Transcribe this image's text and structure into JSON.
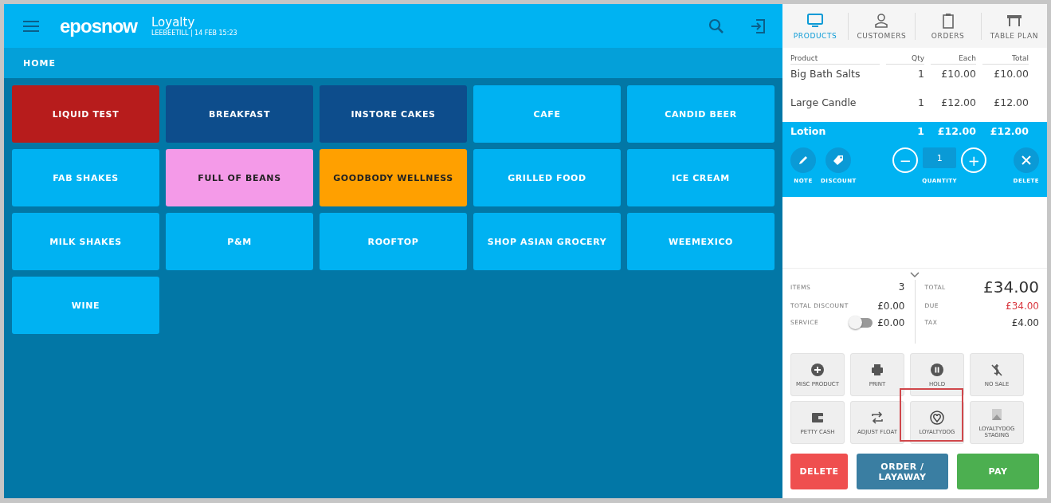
{
  "header": {
    "logo": "eposnow",
    "title": "Loyalty",
    "subtitle": "LEEBEETILL | 14 FEB 15:23"
  },
  "breadcrumb": "HOME",
  "categories": [
    {
      "label": "LIQUID TEST",
      "color": "#b71c1c"
    },
    {
      "label": "BREAKFAST",
      "color": "#0d4d8c"
    },
    {
      "label": "INSTORE CAKES",
      "color": "#0d4d8c"
    },
    {
      "label": "CAFE",
      "color": "#00b2f2"
    },
    {
      "label": "CANDID BEER",
      "color": "#00b2f2"
    },
    {
      "label": "FAB SHAKES",
      "color": "#00b2f2"
    },
    {
      "label": "FULL OF BEANS",
      "color": "#f49ae8"
    },
    {
      "label": "GOODBODY WELLNESS",
      "color": "#ffa000"
    },
    {
      "label": "GRILLED FOOD",
      "color": "#00b2f2"
    },
    {
      "label": "ICE CREAM",
      "color": "#00b2f2"
    },
    {
      "label": "MILK SHAKES",
      "color": "#00b2f2"
    },
    {
      "label": "P&M",
      "color": "#00b2f2"
    },
    {
      "label": "ROOFTOP",
      "color": "#00b2f2"
    },
    {
      "label": "SHOP ASIAN GROCERY",
      "color": "#00b2f2"
    },
    {
      "label": "WEEMEXICO",
      "color": "#00b2f2"
    },
    {
      "label": "WINE",
      "color": "#00b2f2"
    }
  ],
  "tabs": [
    {
      "kind": "monitor",
      "label": "PRODUCTS",
      "selected": true
    },
    {
      "kind": "person",
      "label": "CUSTOMERS",
      "selected": false
    },
    {
      "kind": "clipboard",
      "label": "ORDERS",
      "selected": false
    },
    {
      "kind": "table",
      "label": "TABLE PLAN",
      "selected": false
    }
  ],
  "order": {
    "columns": [
      "Product",
      "Qty",
      "Each",
      "Total"
    ],
    "rows": [
      {
        "product": "Big Bath Salts",
        "qty": "1",
        "each": "£10.00",
        "total": "£10.00",
        "selected": false
      },
      {
        "product": "Large Candle",
        "qty": "1",
        "each": "£12.00",
        "total": "£12.00",
        "selected": false
      },
      {
        "product": "Lotion",
        "qty": "1",
        "each": "£12.00",
        "total": "£12.00",
        "selected": true
      }
    ],
    "actions": {
      "note": "NOTE",
      "discount": "DISCOUNT",
      "minus": "−",
      "quantity": "1",
      "plus": "+",
      "quantity_label": "QUANTITY",
      "delete": "DELETE"
    }
  },
  "totals": {
    "left": [
      {
        "label": "ITEMS",
        "value": "3"
      },
      {
        "label": "TOTAL DISCOUNT",
        "value": "£0.00"
      },
      {
        "label": "SERVICE",
        "value": "£0.00",
        "kind": "toggle",
        "on": false
      }
    ],
    "right": [
      {
        "label": "TOTAL",
        "value": "£34.00",
        "kind": "big"
      },
      {
        "label": "DUE",
        "value": "£34.00",
        "kind": "due"
      },
      {
        "label": "TAX",
        "value": "£4.00"
      }
    ]
  },
  "functions": [
    {
      "kind": "plus",
      "label": "MISC PRODUCT",
      "highlighted": false
    },
    {
      "kind": "print",
      "label": "PRINT",
      "highlighted": false
    },
    {
      "kind": "pause",
      "label": "HOLD",
      "highlighted": false
    },
    {
      "kind": "nosale",
      "label": "NO SALE",
      "highlighted": false
    },
    {
      "kind": "wallet",
      "label": "PETTY CASH",
      "highlighted": false
    },
    {
      "kind": "swap",
      "label": "ADJUST FLOAT",
      "highlighted": false
    },
    {
      "kind": "heart",
      "label": "LOYALTYDOG",
      "highlighted": true
    },
    {
      "kind": "image",
      "label": "LOYALTYDOG STAGING",
      "highlighted": false
    }
  ],
  "bottom_buttons": [
    {
      "kind": "delete",
      "label": "DELETE"
    },
    {
      "kind": "order",
      "label": "ORDER / LAYAWAY"
    },
    {
      "kind": "pay",
      "label": "PAY"
    }
  ]
}
